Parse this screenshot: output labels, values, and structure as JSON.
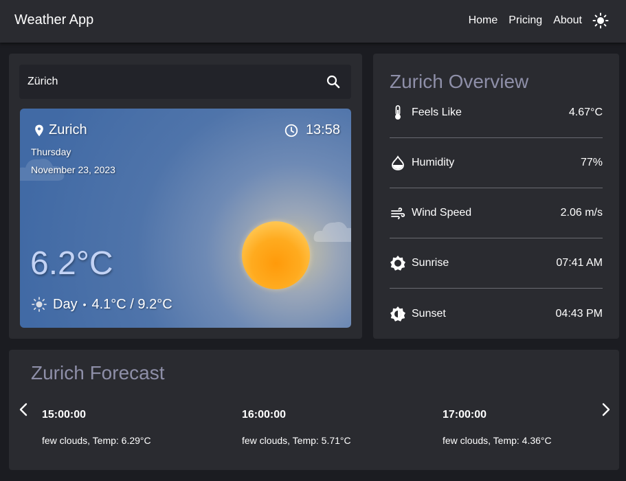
{
  "header": {
    "title": "Weather App",
    "nav": [
      "Home",
      "Pricing",
      "About"
    ],
    "theme_icon": "sun-icon"
  },
  "search": {
    "value": "Zürich",
    "icon": "search-icon"
  },
  "current": {
    "location": "Zurich",
    "time": "13:58",
    "day": "Thursday",
    "date": "November 23, 2023",
    "temp": "6.2°C",
    "period": "Day",
    "range": "4.1°C / 9.2°C"
  },
  "overview": {
    "title": "Zurich Overview",
    "rows": [
      {
        "label": "Feels Like",
        "value": "4.67°C",
        "icon": "thermometer-icon"
      },
      {
        "label": "Humidity",
        "value": "77%",
        "icon": "humidity-icon"
      },
      {
        "label": "Wind Speed",
        "value": "2.06 m/s",
        "icon": "wind-icon"
      },
      {
        "label": "Sunrise",
        "value": "07:41 AM",
        "icon": "sunrise-icon"
      },
      {
        "label": "Sunset",
        "value": "04:43 PM",
        "icon": "sunset-icon"
      }
    ]
  },
  "forecast": {
    "title": "Zurich Forecast",
    "items": [
      {
        "time": "15:00:00",
        "desc": "few clouds, Temp: 6.29°C"
      },
      {
        "time": "16:00:00",
        "desc": "few clouds, Temp: 5.71°C"
      },
      {
        "time": "17:00:00",
        "desc": "few clouds, Temp: 4.36°C"
      }
    ]
  },
  "colors": {
    "background": "#1b1c21",
    "panel": "#2a2b30",
    "heading_muted": "#8e8fa8",
    "temp_text": "#c3d3f5",
    "card_blue": "#416aa5",
    "sun_orange": "#ff9a0a"
  }
}
